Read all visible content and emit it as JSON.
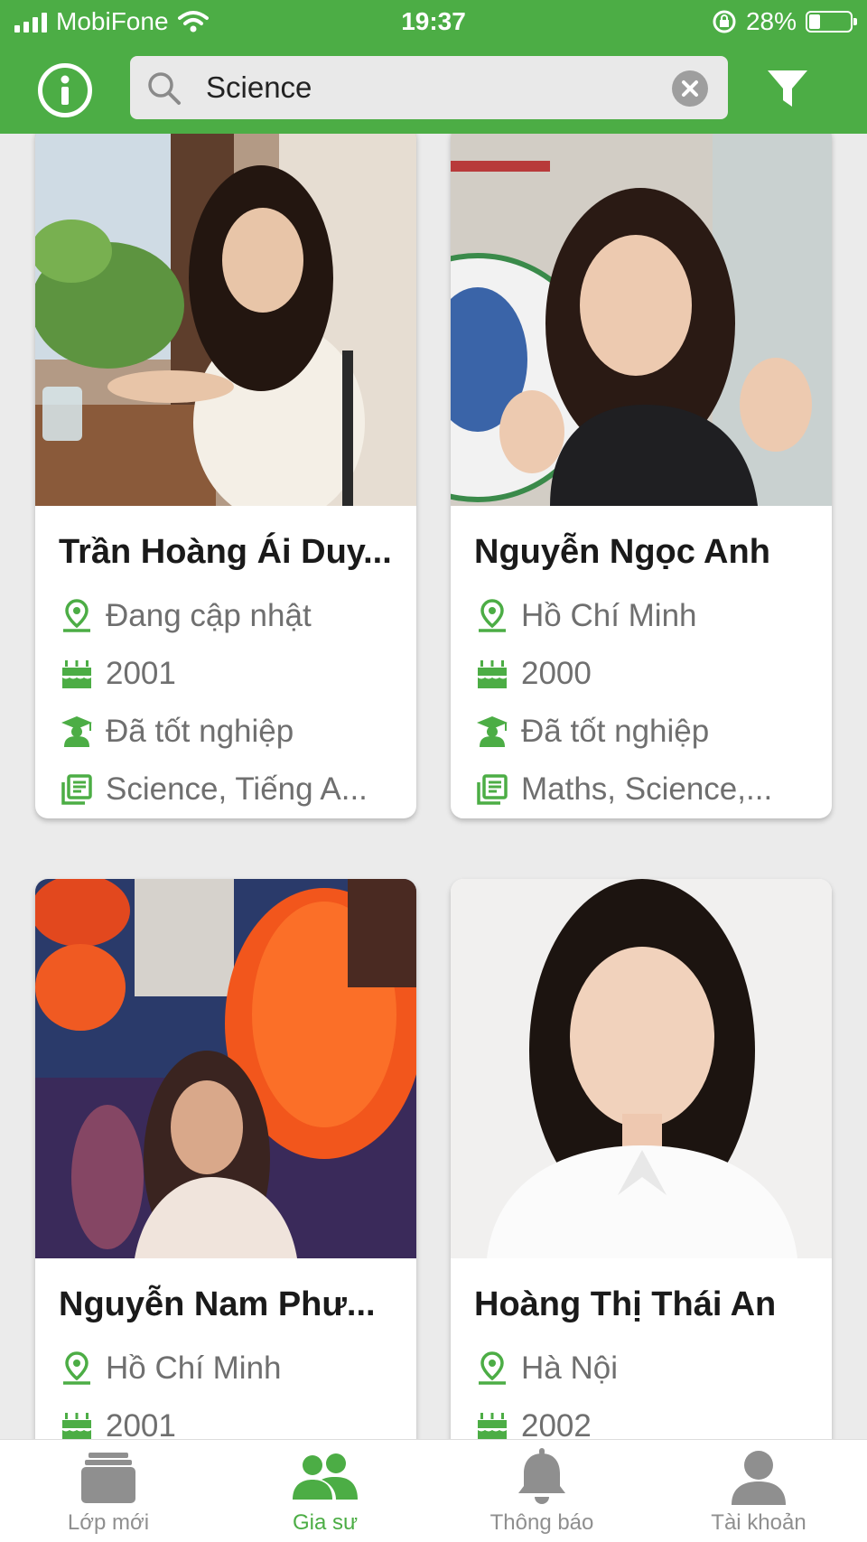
{
  "status_bar": {
    "carrier": "MobiFone",
    "time": "19:37",
    "battery": "28%",
    "battery_level": 0.28
  },
  "header": {
    "search": {
      "value": "Science",
      "placeholder": ""
    }
  },
  "tutors": [
    {
      "name": "Trần Hoàng Ái Duy...",
      "location": "Đang cập nhật",
      "birth_year": "2001",
      "status": "Đã tốt nghiệp",
      "subjects": "Science, Tiếng A..."
    },
    {
      "name": "Nguyễn Ngọc Anh",
      "location": "Hồ Chí Minh",
      "birth_year": "2000",
      "status": "Đã tốt nghiệp",
      "subjects": "Maths, Science,..."
    },
    {
      "name": "Nguyễn Nam Phư...",
      "location": "Hồ Chí Minh",
      "birth_year": "2001"
    },
    {
      "name": "Hoàng Thị Thái An",
      "location": "Hà Nội",
      "birth_year": "2002"
    }
  ],
  "tabs": [
    {
      "label": "Lớp mới",
      "icon": "folder-icon"
    },
    {
      "label": "Gia sư",
      "icon": "people-icon"
    },
    {
      "label": "Thông báo",
      "icon": "bell-icon"
    },
    {
      "label": "Tài khoản",
      "icon": "user-icon"
    }
  ],
  "colors": {
    "brand": "#4cad45",
    "inactive": "#8f8f8f"
  }
}
